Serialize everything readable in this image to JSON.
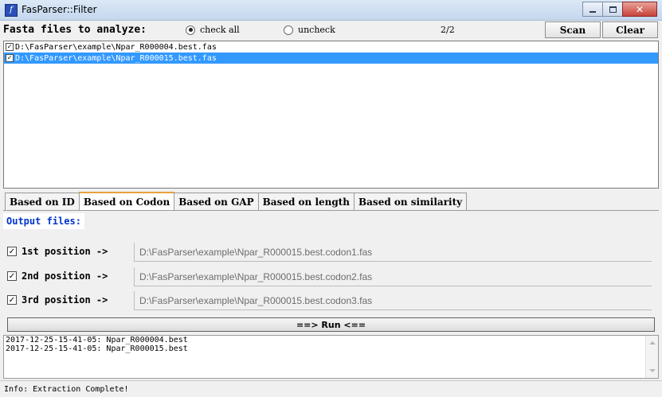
{
  "window": {
    "title": "FasParser::Filter",
    "app_icon": "fasparser-logo-icon",
    "controls": [
      "minimize-icon",
      "maximize-icon",
      "close-icon"
    ]
  },
  "toolbar": {
    "heading": "Fasta files to analyze:",
    "check_all_label": "check all",
    "check_all_selected": true,
    "uncheck_label": "uncheck",
    "uncheck_selected": false,
    "count": "2/2",
    "scan_label": "Scan",
    "clear_label": "Clear"
  },
  "files": [
    {
      "path": "D:\\FasParser\\example\\Npar_R000004.best.fas",
      "checked": true,
      "selected": false
    },
    {
      "path": "D:\\FasParser\\example\\Npar_R000015.best.fas",
      "checked": true,
      "selected": true
    }
  ],
  "tabs": [
    {
      "label": "Based on ID",
      "active": false
    },
    {
      "label": "Based on Codon",
      "active": true
    },
    {
      "label": "Based on GAP",
      "active": false
    },
    {
      "label": "Based on length",
      "active": false
    },
    {
      "label": "Based on similarity",
      "active": false
    }
  ],
  "codon_panel": {
    "output_label": "Output files:",
    "positions": [
      {
        "label": "1st position ->",
        "checked": true,
        "path": "D:\\FasParser\\example\\Npar_R000015.best.codon1.fas"
      },
      {
        "label": "2nd position ->",
        "checked": true,
        "path": "D:\\FasParser\\example\\Npar_R000015.best.codon2.fas"
      },
      {
        "label": "3rd position ->",
        "checked": true,
        "path": "D:\\FasParser\\example\\Npar_R000015.best.codon3.fas"
      }
    ],
    "run_label": "==> Run <=="
  },
  "log": [
    "2017-12-25-15-41-05: Npar_R000004.best",
    "2017-12-25-15-41-05: Npar_R000015.best"
  ],
  "status": "Info: Extraction Complete!",
  "colors": {
    "selection": "#3399ff",
    "active_tab_accent": "#e8a23d",
    "output_label": "#0033cc"
  }
}
